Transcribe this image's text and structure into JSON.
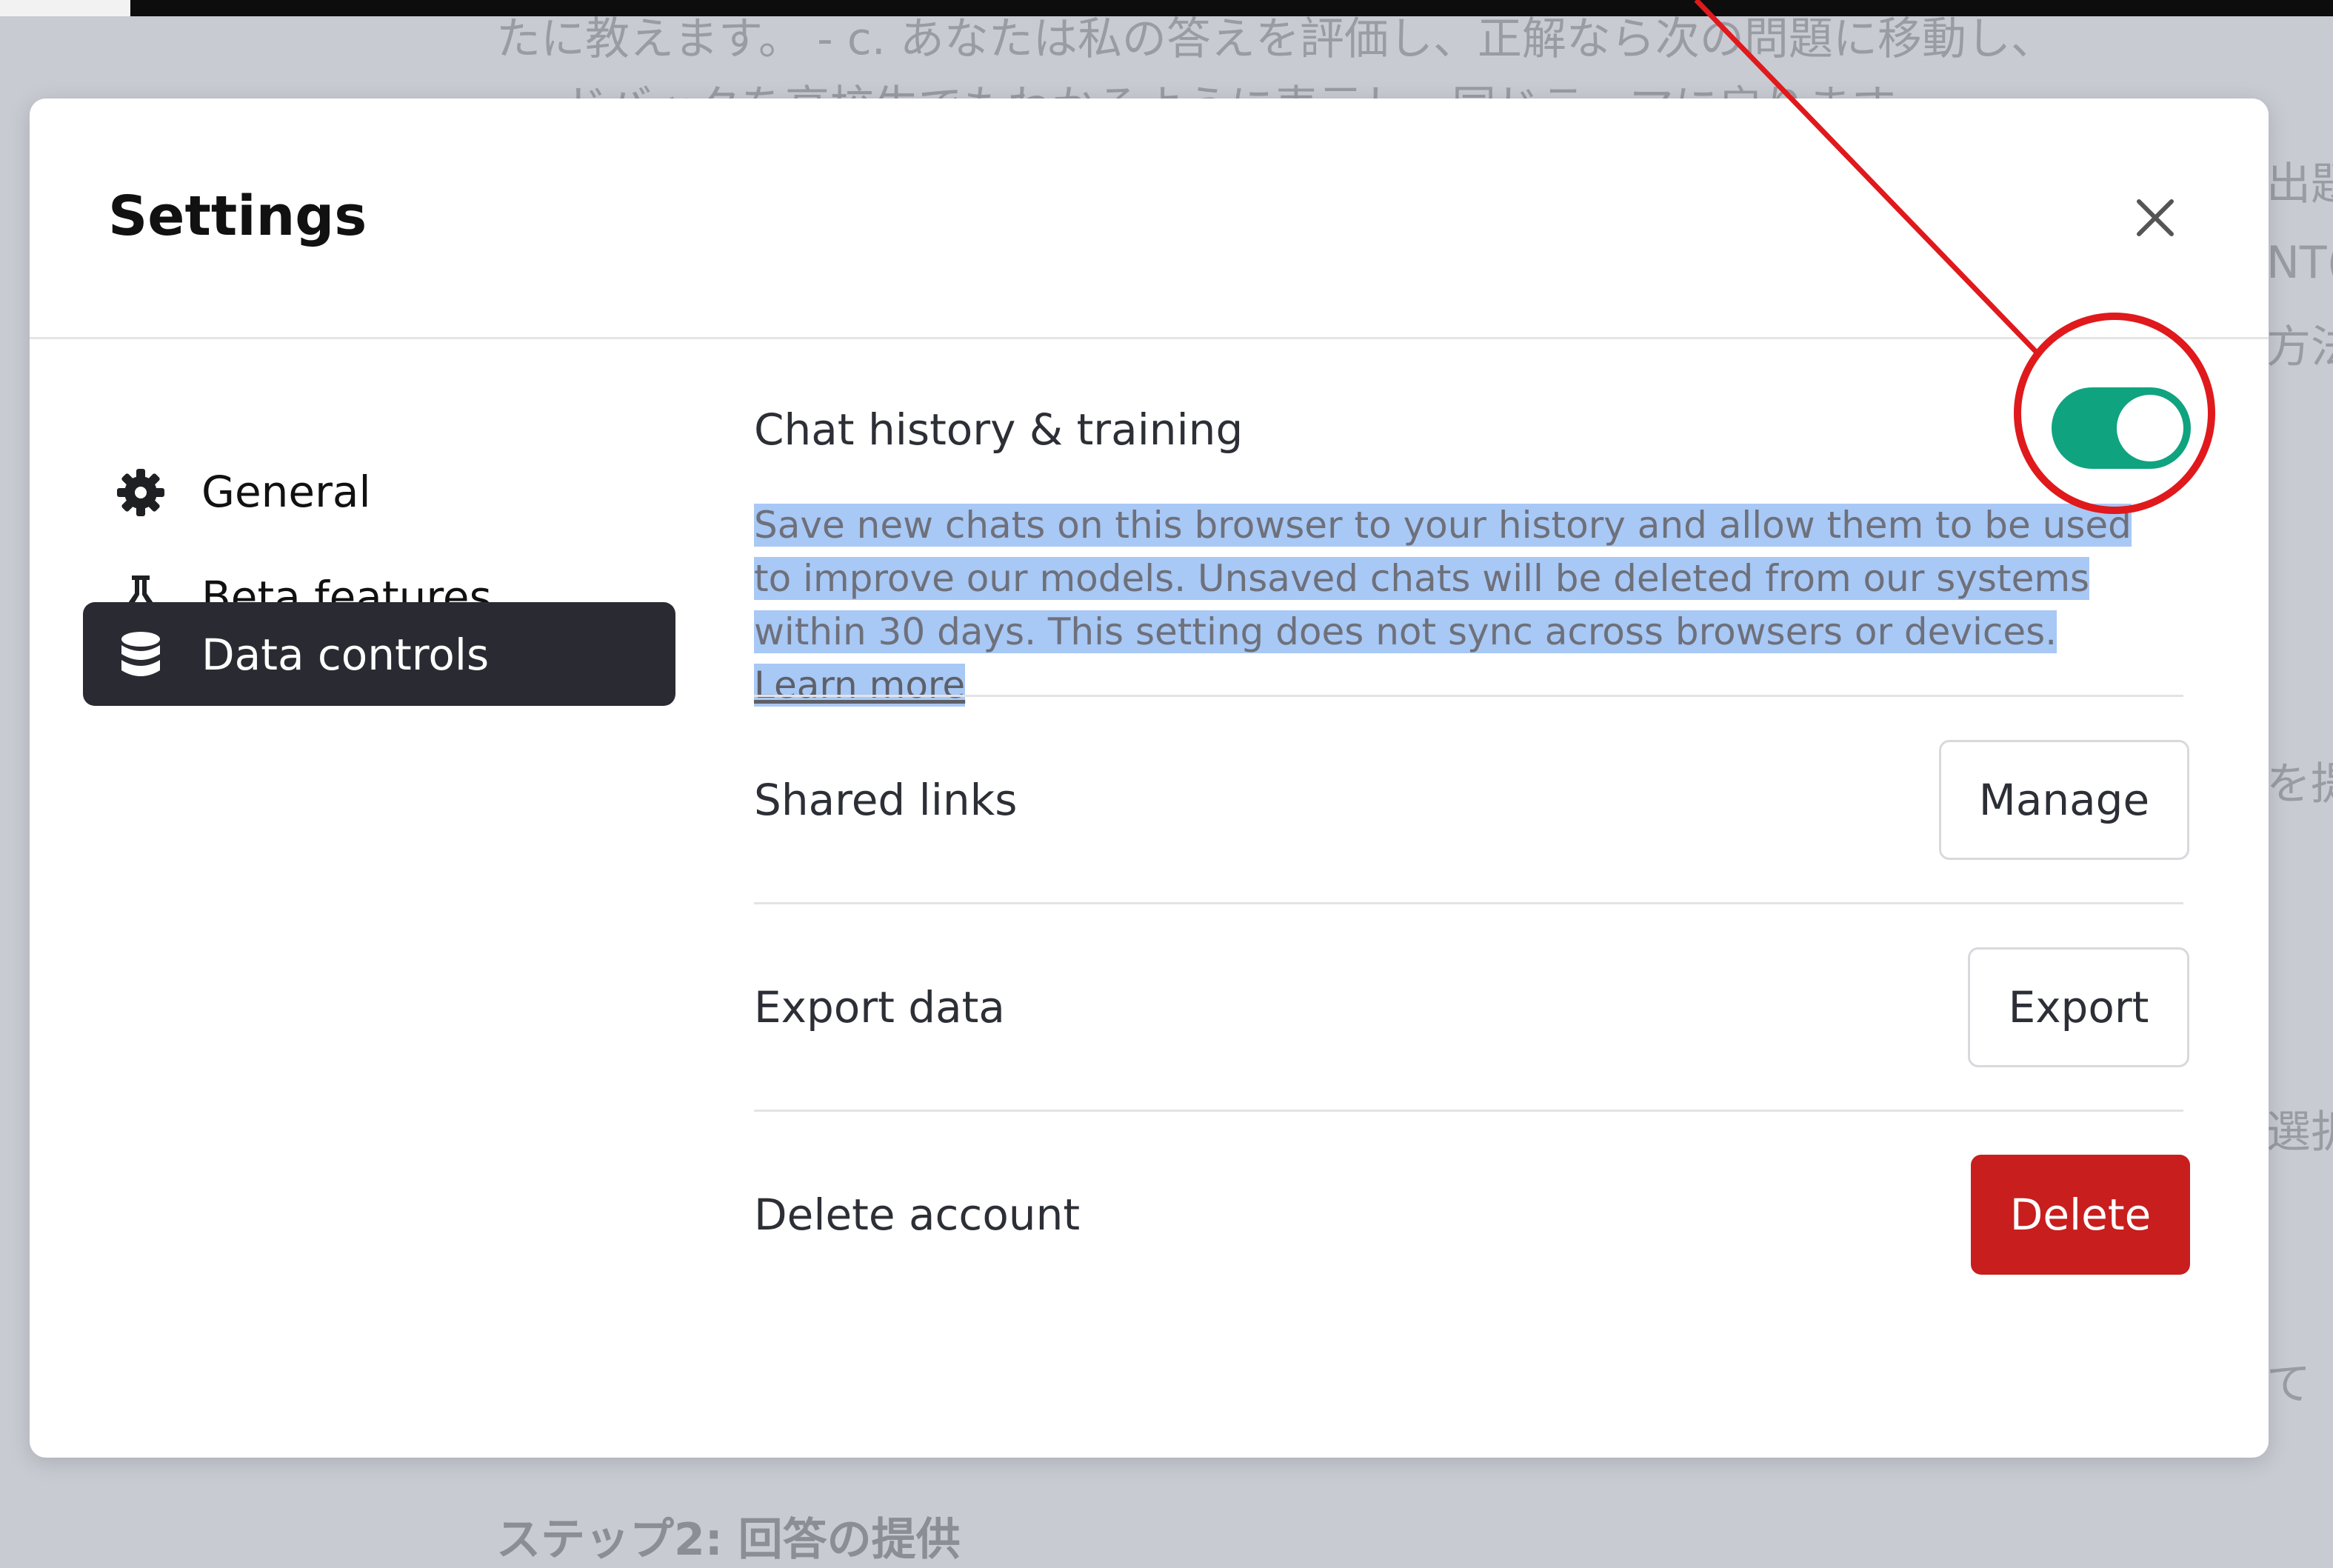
{
  "background": {
    "line1": "たに教えます。 - c. あなたは私の答えを評価し、正解なら次の問題に移動し、",
    "line2": "ードバックを高校生でもわかるように表示し、同じテーマに戻ります。",
    "right_1": "出題",
    "right_2": "NT(",
    "right_3": "方法",
    "right_4": "を提",
    "right_5": "選択",
    "right_6": "て",
    "bottom": "ステップ2: 回答の提供"
  },
  "modal": {
    "title": "Settings"
  },
  "sidebar": {
    "items": [
      {
        "label": "General",
        "icon": "gear-icon",
        "active": false
      },
      {
        "label": "Beta features",
        "icon": "flask-icon",
        "active": false
      },
      {
        "label": "Data controls",
        "icon": "database-icon",
        "active": true
      }
    ]
  },
  "data_controls": {
    "chat_history": {
      "title": "Chat history & training",
      "description": "Save new chats on this browser to your history and allow them to be used to improve our models. Unsaved chats will be deleted from our systems within 30 days. This setting does not sync across browsers or devices.",
      "learn_more": "Learn more",
      "enabled": true
    },
    "shared_links": {
      "title": "Shared links",
      "button": "Manage"
    },
    "export_data": {
      "title": "Export data",
      "button": "Export"
    },
    "delete_account": {
      "title": "Delete account",
      "button": "Delete"
    }
  },
  "colors": {
    "toggle_on": "#10a37f",
    "delete": "#c81e1e",
    "active_nav": "#2a2b32",
    "annotation": "#e0191c",
    "highlight": "#a8c8f5"
  }
}
